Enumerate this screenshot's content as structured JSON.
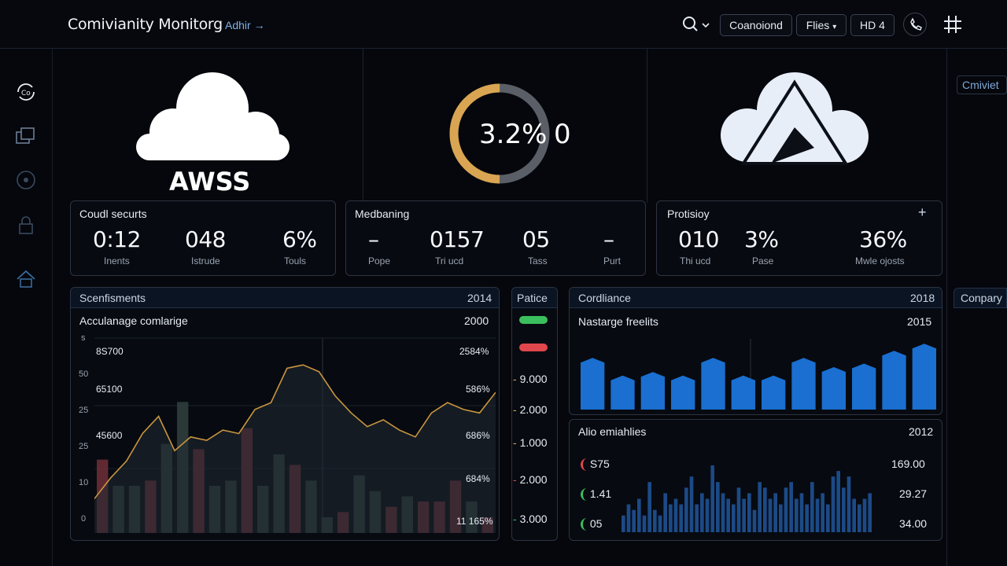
{
  "header": {
    "title": "Comivianity Monitorg",
    "admin_link": "Adhir",
    "buttons": [
      "Coanoiond",
      "Flies",
      "HD 4"
    ]
  },
  "cards": {
    "aws": {
      "label": "AWSS"
    },
    "gauge": {
      "value_text": "3.2%",
      "suffix": "0",
      "fill_fraction": 0.5
    }
  },
  "right_edge": {
    "top_label": "Cmiviet",
    "mid_label": "Conpary"
  },
  "panels": {
    "cloud_security": {
      "title": "Coudl securts",
      "metrics": [
        {
          "value": "0:12",
          "label": "Inents"
        },
        {
          "value": "048",
          "label": "Istrude"
        },
        {
          "value": "6%",
          "label": "Touls"
        }
      ]
    },
    "medbaning": {
      "title": "Medbaning",
      "metrics": [
        {
          "value": "–",
          "label": "Pope"
        },
        {
          "value": "0157",
          "label": "Tri ucd"
        },
        {
          "value": "05",
          "label": "Tass"
        },
        {
          "value": "–",
          "label": "Purt"
        }
      ]
    },
    "protisiloy": {
      "title": "Protisioy",
      "plus": "+",
      "metrics": [
        {
          "value": "010",
          "label": "Thi ucd"
        },
        {
          "value": "3%",
          "label": "Pase"
        },
        {
          "value": "36%",
          "label": "Mwle ojosts"
        }
      ]
    }
  },
  "sentiments": {
    "header": "Scenfisments",
    "header_year": "2014",
    "chart_title": "Acculanage comlarige",
    "chart_year": "2000",
    "left_ticks": [
      "s",
      "50",
      "25",
      "25",
      "10",
      "0"
    ],
    "left_values": [
      "8S700",
      "65100",
      "45600"
    ],
    "right_labels": [
      "2584%",
      "586%",
      "686%",
      "684%",
      "11 165%"
    ]
  },
  "palitice": {
    "header": "Patice",
    "pill_colors": [
      "#3bbf5e",
      "#e0474c"
    ],
    "levels": [
      "9.000",
      "2.000",
      "1.000",
      "2.000",
      "3.000"
    ]
  },
  "cordliance": {
    "header": "Cordliance",
    "header_year": "2018",
    "chart_title": "Nastarge freelits",
    "chart_year": "2015"
  },
  "alio": {
    "title": "Alio emiahlies",
    "year": "2012",
    "left_rows": [
      {
        "value": "S75",
        "color": "#e0474c"
      },
      {
        "value": "1.41",
        "color": "#3bbf5e"
      },
      {
        "value": "05",
        "color": "#3bbf5e"
      }
    ],
    "right_values": [
      "169.00",
      "29.27",
      "34.00"
    ]
  },
  "chart_data": [
    {
      "type": "line",
      "title": "Acculanage comlarige",
      "series": [
        {
          "values": [
            10,
            16,
            21,
            29,
            34,
            24,
            28,
            27,
            30,
            29,
            36,
            38,
            48,
            49,
            47,
            40,
            35,
            31,
            33,
            30,
            28,
            35,
            38,
            36,
            35,
            41
          ]
        }
      ]
    },
    {
      "type": "bar",
      "series": [
        {
          "values": [
            14,
            9,
            9,
            10,
            17,
            25,
            16,
            9,
            10,
            20,
            9,
            15,
            13,
            10,
            3,
            4,
            11,
            8,
            5,
            7,
            6,
            6,
            10,
            6,
            3
          ]
        }
      ]
    },
    {
      "type": "bar",
      "title": "Nastarge freelits",
      "series": [
        {
          "values": [
            73,
            48,
            53,
            48,
            73,
            48,
            48,
            73,
            60,
            65,
            83,
            93
          ]
        }
      ]
    },
    {
      "type": "bar",
      "title": "Alio emiahlies",
      "series": [
        {
          "values": [
            3,
            5,
            4,
            6,
            3,
            9,
            4,
            3,
            7,
            5,
            6,
            5,
            8,
            10,
            5,
            7,
            6,
            12,
            9,
            7,
            6,
            5,
            8,
            6,
            7,
            4,
            9,
            8,
            6,
            7,
            5,
            8,
            9,
            6,
            7,
            5,
            9,
            6,
            7,
            5,
            10,
            11,
            8,
            10,
            6,
            5,
            6,
            7
          ]
        }
      ]
    }
  ]
}
